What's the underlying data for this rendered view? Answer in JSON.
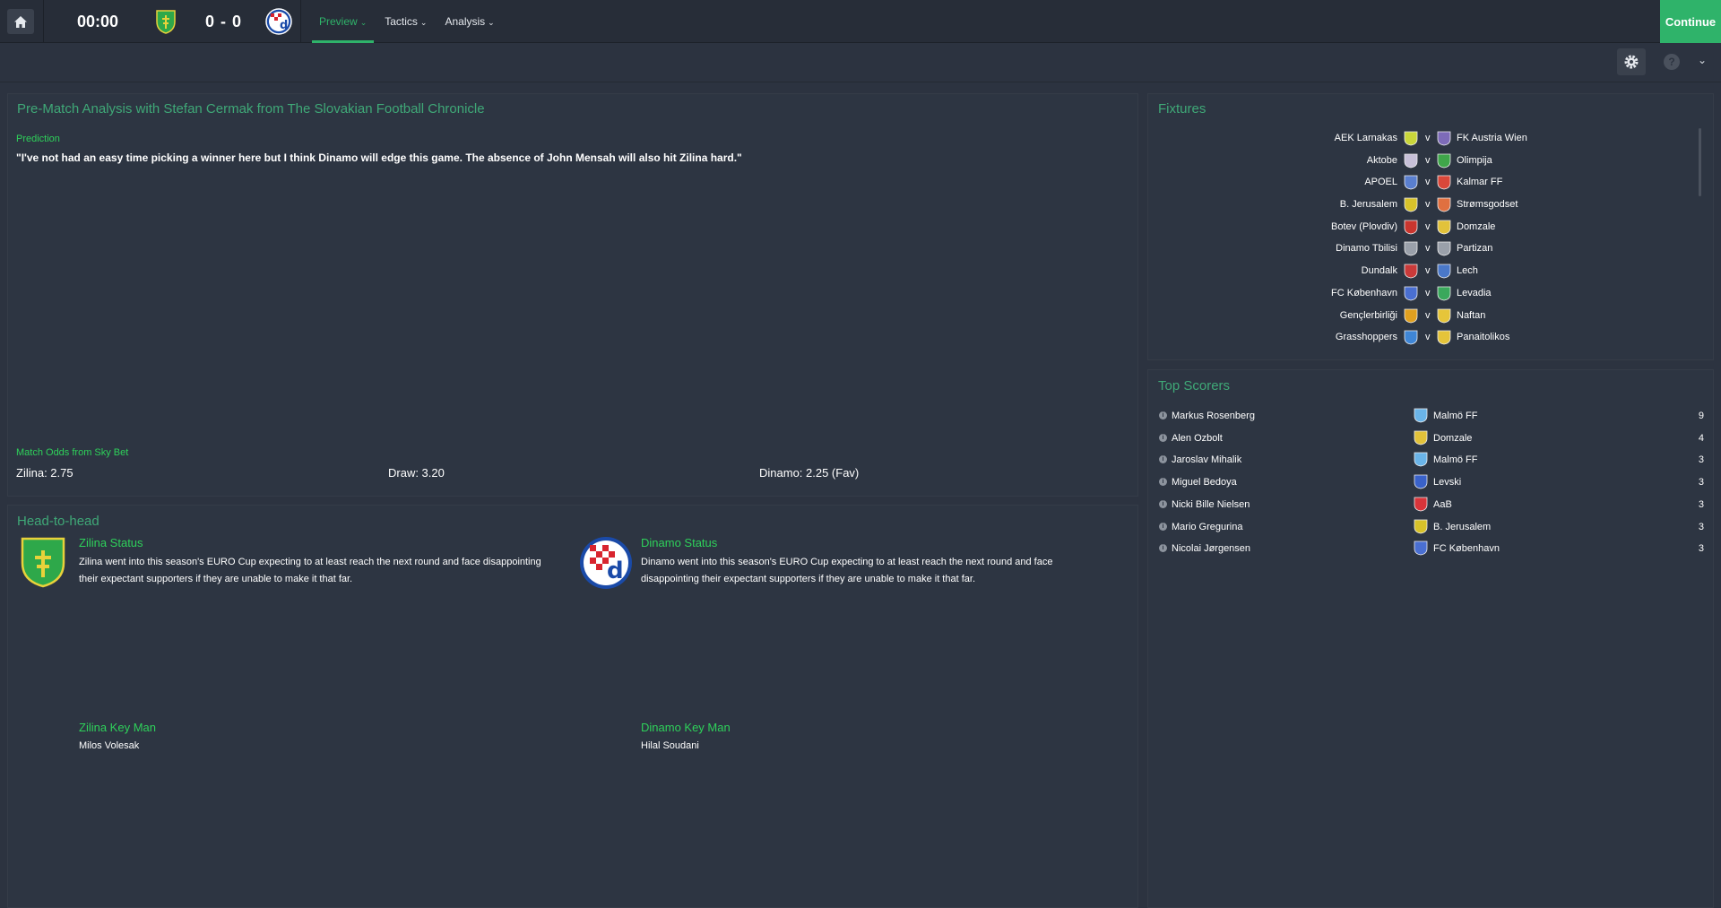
{
  "topbar": {
    "clock": "00:00",
    "score": "0 - 0",
    "nav": [
      {
        "label": "Preview"
      },
      {
        "label": "Tactics"
      },
      {
        "label": "Analysis"
      }
    ],
    "continue_label": "Continue"
  },
  "subbar": {
    "help_label": "?"
  },
  "analysis": {
    "title": "Pre-Match Analysis with Stefan Cermak from The Slovakian Football Chronicle",
    "prediction_label": "Prediction",
    "quote": "\"I've not had an easy time picking a winner here but I think Dinamo will edge this game. The absence of John Mensah will also hit Zilina hard.\"",
    "odds_label": "Match Odds from Sky Bet",
    "odds_home": "Zilina: 2.75",
    "odds_draw": "Draw: 3.20",
    "odds_away": "Dinamo: 2.25 (Fav)"
  },
  "h2h": {
    "title": "Head-to-head",
    "home": {
      "status_title": "Zilina Status",
      "status_text": "Zilina went into this season's EURO Cup expecting to at least reach the next round and face disappointing their expectant supporters if they are unable to make it that far.",
      "keyman_title": "Zilina Key Man",
      "keyman_name": "Milos Volesak"
    },
    "away": {
      "status_title": "Dinamo Status",
      "status_text": "Dinamo went into this season's EURO Cup expecting to at least reach the next round and face disappointing their expectant supporters if they are unable to make it that far.",
      "keyman_title": "Dinamo Key Man",
      "keyman_name": "Hilal Soudani"
    }
  },
  "fixtures": {
    "title": "Fixtures",
    "v_label": "v",
    "rows": [
      {
        "home": "AEK Larnakas",
        "away": "FK Austria Wien",
        "hcolor": "#c9d63a",
        "acolor": "#7d6bb8"
      },
      {
        "home": "Aktobe",
        "away": "Olimpija",
        "hcolor": "#c7c0d8",
        "acolor": "#3fa64a"
      },
      {
        "home": "APOEL",
        "away": "Kalmar FF",
        "hcolor": "#5a7fcf",
        "acolor": "#d9473a"
      },
      {
        "home": "B. Jerusalem",
        "away": "Strømsgodset",
        "hcolor": "#d8c22a",
        "acolor": "#e07040"
      },
      {
        "home": "Botev (Plovdiv)",
        "away": "Domzale",
        "hcolor": "#c9352e",
        "acolor": "#e2c23a"
      },
      {
        "home": "Dinamo Tbilisi",
        "away": "Partizan",
        "hcolor": "#9aa0aa",
        "acolor": "#9aa0aa"
      },
      {
        "home": "Dundalk",
        "away": "Lech",
        "hcolor": "#c93a3a",
        "acolor": "#4a78c9"
      },
      {
        "home": "FC København",
        "away": "Levadia",
        "hcolor": "#4a6fd1",
        "acolor": "#3aa85c"
      },
      {
        "home": "Gençlerbirliği",
        "away": "Naftan",
        "hcolor": "#e0a020",
        "acolor": "#e6c53a"
      },
      {
        "home": "Grasshoppers",
        "away": "Panaitolikos",
        "hcolor": "#3f86d6",
        "acolor": "#e5c43a"
      }
    ]
  },
  "scorers": {
    "title": "Top Scorers",
    "rows": [
      {
        "name": "Markus Rosenberg",
        "club": "Malmö FF",
        "goals": "9",
        "color": "#6ab4e8"
      },
      {
        "name": "Alen Ozbolt",
        "club": "Domzale",
        "goals": "4",
        "color": "#e2c23a"
      },
      {
        "name": "Jaroslav Mihalik",
        "club": "Malmö FF",
        "goals": "3",
        "color": "#6ab4e8"
      },
      {
        "name": "Miguel Bedoya",
        "club": "Levski",
        "goals": "3",
        "color": "#3a62c9"
      },
      {
        "name": "Nicki Bille Nielsen",
        "club": "AaB",
        "goals": "3",
        "color": "#d8343a"
      },
      {
        "name": "Mario Gregurina",
        "club": "B. Jerusalem",
        "goals": "3",
        "color": "#d8c22a"
      },
      {
        "name": "Nicolai Jørgensen",
        "club": "FC København",
        "goals": "3",
        "color": "#4a6fd1"
      }
    ]
  },
  "colors": {
    "accent": "#2fb36a",
    "title_green": "#3fa877",
    "label_green": "#2ed15a",
    "background": "#2c3340"
  }
}
